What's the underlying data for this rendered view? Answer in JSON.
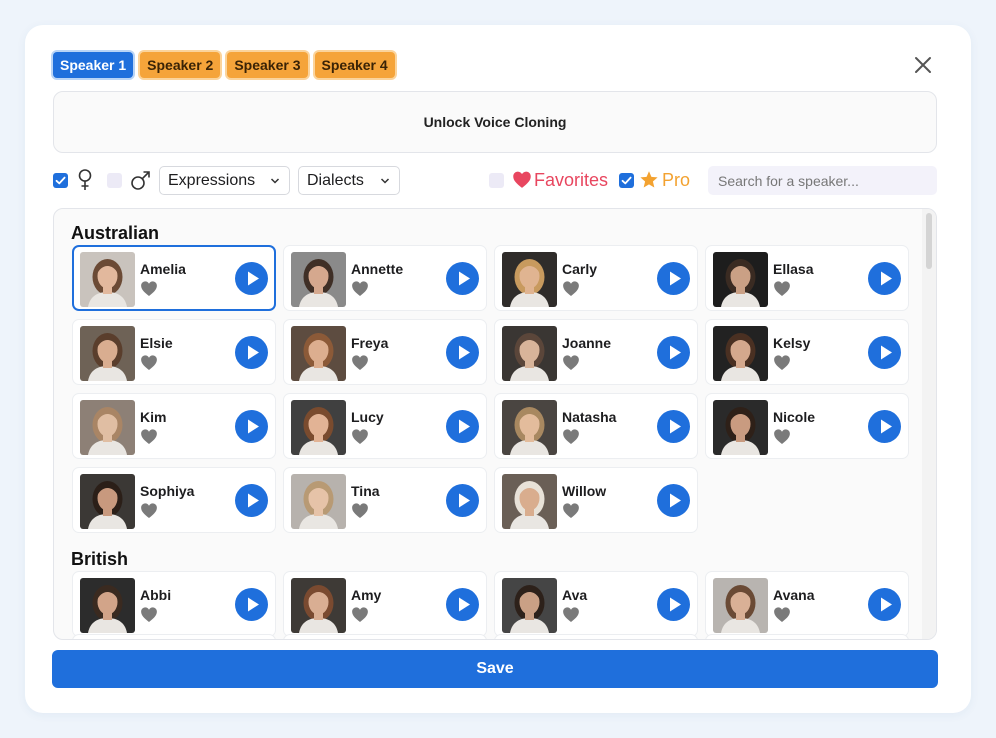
{
  "tabs": [
    {
      "label": "Speaker 1",
      "active": true
    },
    {
      "label": "Speaker 2",
      "active": false
    },
    {
      "label": "Speaker 3",
      "active": false
    },
    {
      "label": "Speaker 4",
      "active": false
    }
  ],
  "unlock_label": "Unlock Voice Cloning",
  "filters": {
    "female_checked": true,
    "male_checked": false,
    "female_icon": "female-symbol-icon",
    "male_icon": "male-symbol-icon",
    "expressions_label": "Expressions",
    "dialects_label": "Dialects",
    "favorites_checked": false,
    "favorites_label": "Favorites",
    "pro_checked": true,
    "pro_label": "Pro",
    "search_placeholder": "Search for a speaker..."
  },
  "sections": [
    {
      "title": "Australian",
      "speakers": [
        "Amelia",
        "Annette",
        "Carly",
        "Ellasa",
        "Elsie",
        "Freya",
        "Joanne",
        "Kelsy",
        "Kim",
        "Lucy",
        "Natasha",
        "Nicole",
        "Sophiya",
        "Tina",
        "Willow"
      ]
    },
    {
      "title": "British",
      "speakers": [
        "Abbi",
        "Amy",
        "Ava",
        "Avana"
      ]
    }
  ],
  "selected_speaker": "Amelia",
  "save_label": "Save",
  "colors": {
    "accent": "#1f6fdc",
    "tab_inactive": "#f5a43a",
    "favorites": "#e8465f",
    "pro": "#f3a230",
    "heart_gray": "#7a7a7a"
  }
}
